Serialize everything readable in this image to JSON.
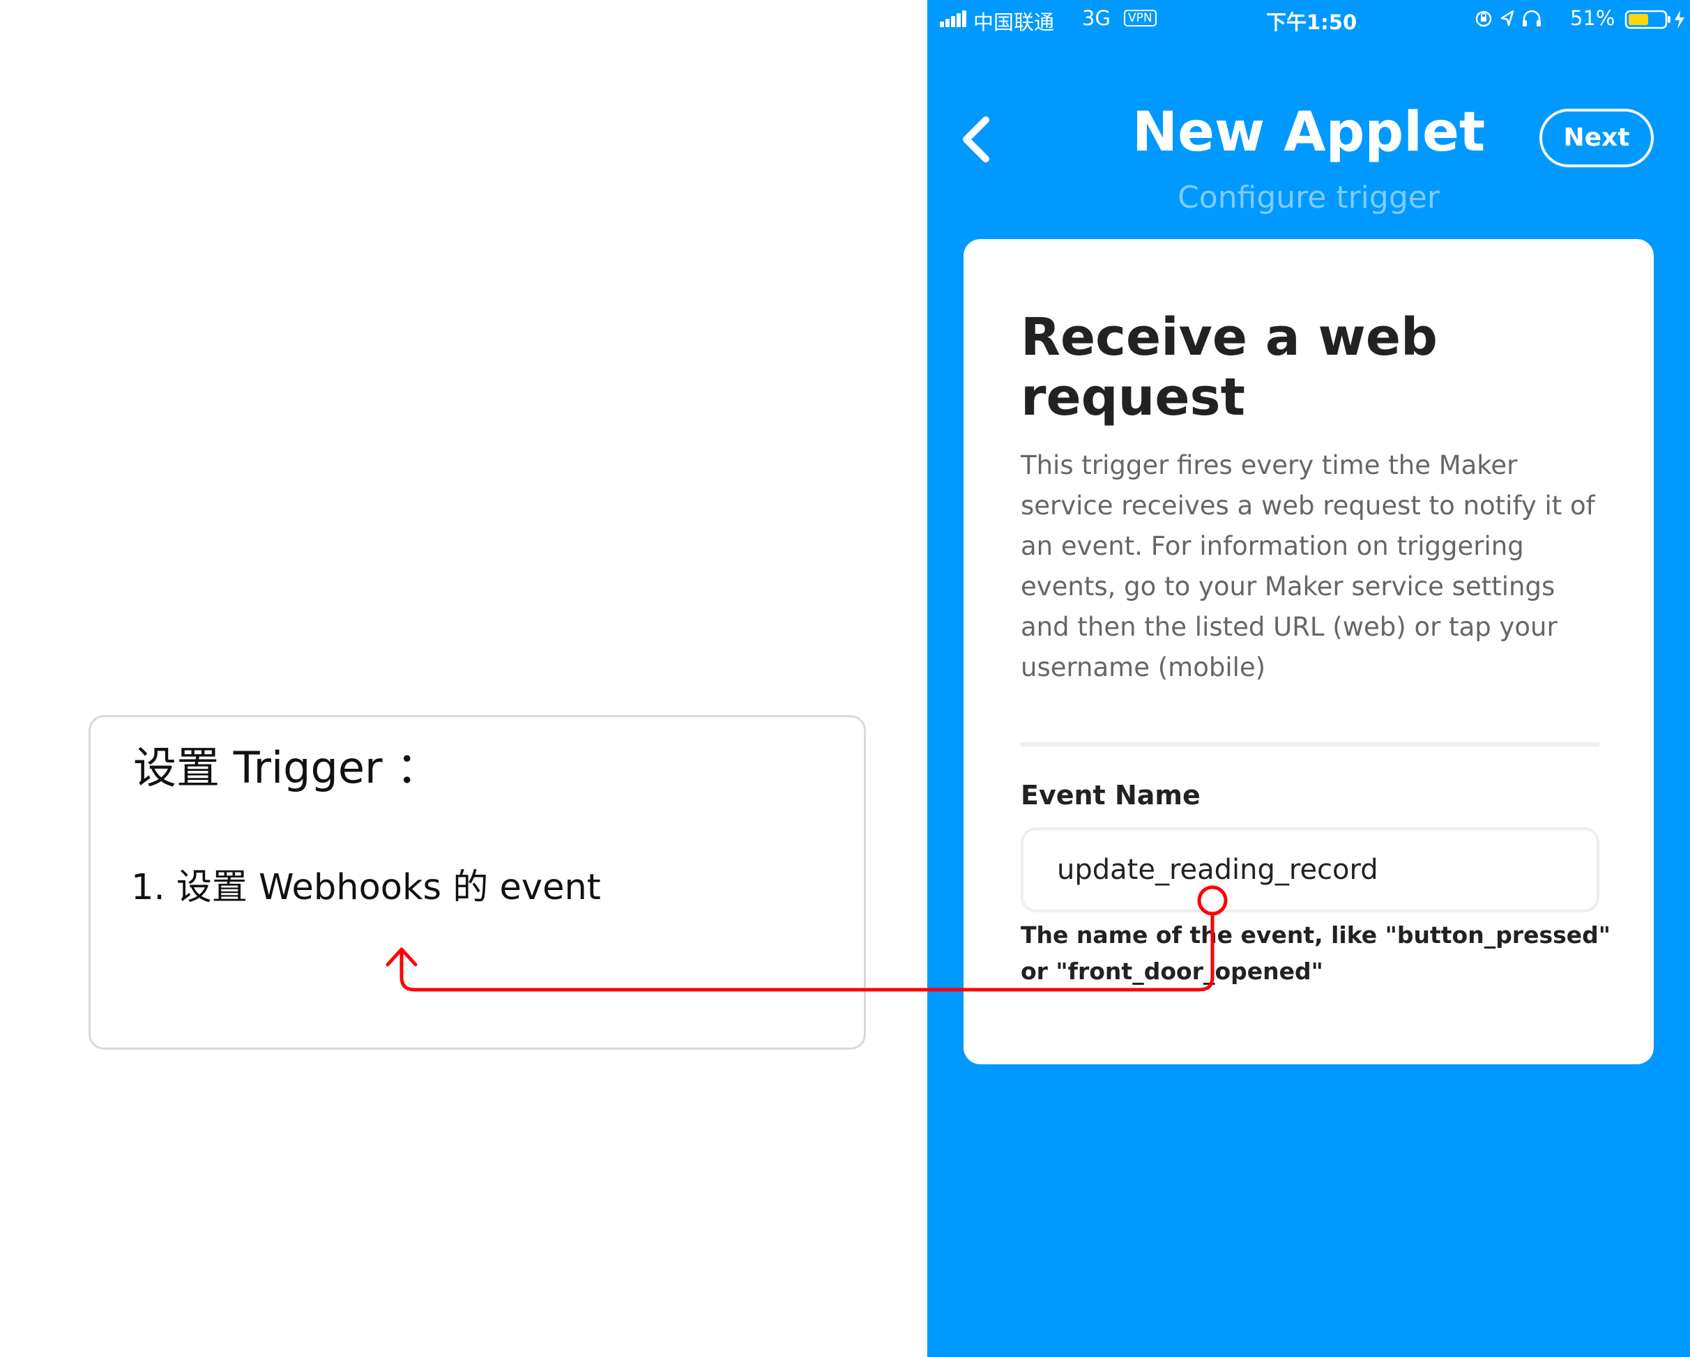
{
  "annotation": {
    "title": "设置 Trigger ：",
    "step_1": "1. 设置 Webhooks 的 event",
    "arrow_color": "#ff0000"
  },
  "status_bar": {
    "carrier": "中国联通",
    "network": "3G",
    "vpn_badge": "VPN",
    "time": "下午1:50",
    "battery_percent": "51%",
    "icons": [
      "signal-icon",
      "orientation-lock-icon",
      "location-icon",
      "headphones-icon",
      "battery-icon",
      "charging-icon"
    ]
  },
  "nav": {
    "back_icon": "chevron-left-icon",
    "title": "New Applet",
    "subtitle": "Configure trigger",
    "next_label": "Next"
  },
  "card": {
    "heading": "Receive a web request",
    "description": "This trigger fires every time the Maker service receives a web request to notify it of an event. For information on triggering events, go to your Maker service settings and then the listed URL (web) or tap your username (mobile)",
    "field_label": "Event Name",
    "field_value": "update_reading_record",
    "field_help": "The name of the event, like \"button_pressed\" or \"front_door_opened\""
  },
  "colors": {
    "background_blue": "#0099ff",
    "subtitle_blue": "#7fcbff",
    "card_white": "#ffffff",
    "text_dark": "#222222",
    "text_muted": "#666666"
  }
}
